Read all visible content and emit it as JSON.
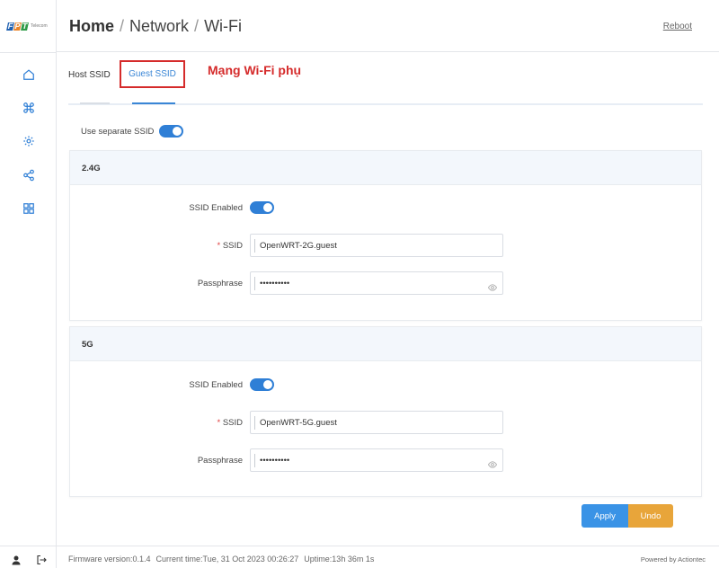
{
  "brand": {
    "logo_letters": [
      "F",
      "P",
      "T"
    ],
    "logo_sub": "Telecom"
  },
  "header": {
    "crumbs": [
      "Home",
      "Network",
      "Wi-Fi"
    ],
    "separator": "/",
    "reboot_label": "Reboot"
  },
  "sidebar": {
    "items": [
      {
        "icon": "home-icon"
      },
      {
        "icon": "command-icon"
      },
      {
        "icon": "gear-icon"
      },
      {
        "icon": "share-icon"
      },
      {
        "icon": "grid-icon"
      }
    ],
    "bottom": [
      {
        "icon": "user-icon"
      },
      {
        "icon": "logout-icon"
      }
    ]
  },
  "tabs": {
    "items": [
      {
        "label": "Host SSID",
        "active": false
      },
      {
        "label": "Guest SSID",
        "active": true
      }
    ],
    "annotation": "Mạng Wi-Fi phụ"
  },
  "main": {
    "separate_ssid_label": "Use separate SSID",
    "separate_ssid_on": true,
    "bands": [
      {
        "title": "2.4G",
        "ssid_enabled_label": "SSID Enabled",
        "ssid_enabled_on": true,
        "ssid_label": "SSID",
        "ssid_value": "OpenWRT-2G.guest",
        "passphrase_label": "Passphrase",
        "passphrase_value": "••••••••••"
      },
      {
        "title": "5G",
        "ssid_enabled_label": "SSID Enabled",
        "ssid_enabled_on": true,
        "ssid_label": "SSID",
        "ssid_value": "OpenWRT-5G.guest",
        "passphrase_label": "Passphrase",
        "passphrase_value": "••••••••••"
      }
    ],
    "required_mark": "*"
  },
  "actions": {
    "apply_label": "Apply",
    "undo_label": "Undo"
  },
  "footer": {
    "firmware": "Firmware version:0.1.4",
    "current_time": "Current time:Tue, 31 Oct 2023 00:26:27",
    "uptime": "Uptime:13h 36m 1s",
    "powered_by": "Powered by Actiontec"
  },
  "colors": {
    "accent": "#2f7fd6",
    "highlight": "#d52b2b",
    "apply": "#3a93e6",
    "undo": "#e8a53a"
  }
}
